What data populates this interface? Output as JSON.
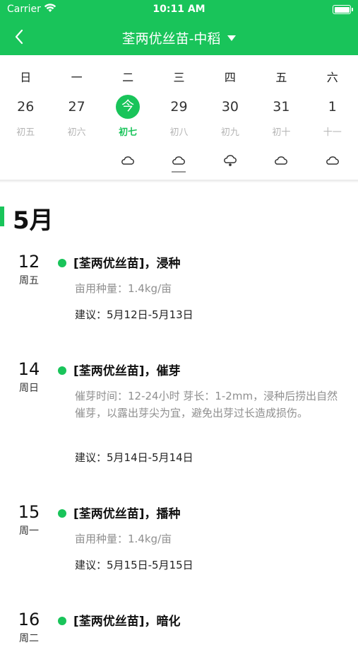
{
  "status": {
    "carrier": "Carrier",
    "time": "10:11 AM"
  },
  "header": {
    "title": "荃两优丝苗-中稻"
  },
  "calendar": {
    "weekdays": [
      "日",
      "一",
      "二",
      "三",
      "四",
      "五",
      "六"
    ],
    "days": [
      "26",
      "27",
      "今",
      "29",
      "30",
      "31",
      "1"
    ],
    "lunar": [
      "初五",
      "初六",
      "初七",
      "初八",
      "初九",
      "初十",
      "十一"
    ],
    "today_index": 2,
    "weather_icons": [
      "",
      "",
      "cloudy-icon",
      "cloudy-icon",
      "snow-cloud-icon",
      "cloudy-icon",
      "cloudy-icon"
    ]
  },
  "month": "5月",
  "tasks": [
    {
      "day": "12",
      "weekday": "周五",
      "title": "[荃两优丝苗]，浸种",
      "desc": "亩用种量：1.4kg/亩",
      "suggest": "建议：5月12日-5月13日"
    },
    {
      "day": "14",
      "weekday": "周日",
      "title": "[荃两优丝苗]，催芽",
      "desc": "催芽时间：12-24小时 芽长：1-2mm，浸种后捞出自然催芽，以露出芽尖为宜，避免出芽过长造成损伤。",
      "suggest": "建议：5月14日-5月14日"
    },
    {
      "day": "15",
      "weekday": "周一",
      "title": "[荃两优丝苗]，播种",
      "desc": "亩用种量：1.4kg/亩",
      "suggest": "建议：5月15日-5月15日"
    },
    {
      "day": "16",
      "weekday": "周二",
      "title": "[荃两优丝苗]，暗化",
      "desc": "",
      "suggest": ""
    }
  ],
  "colors": {
    "accent": "#19c45a"
  }
}
